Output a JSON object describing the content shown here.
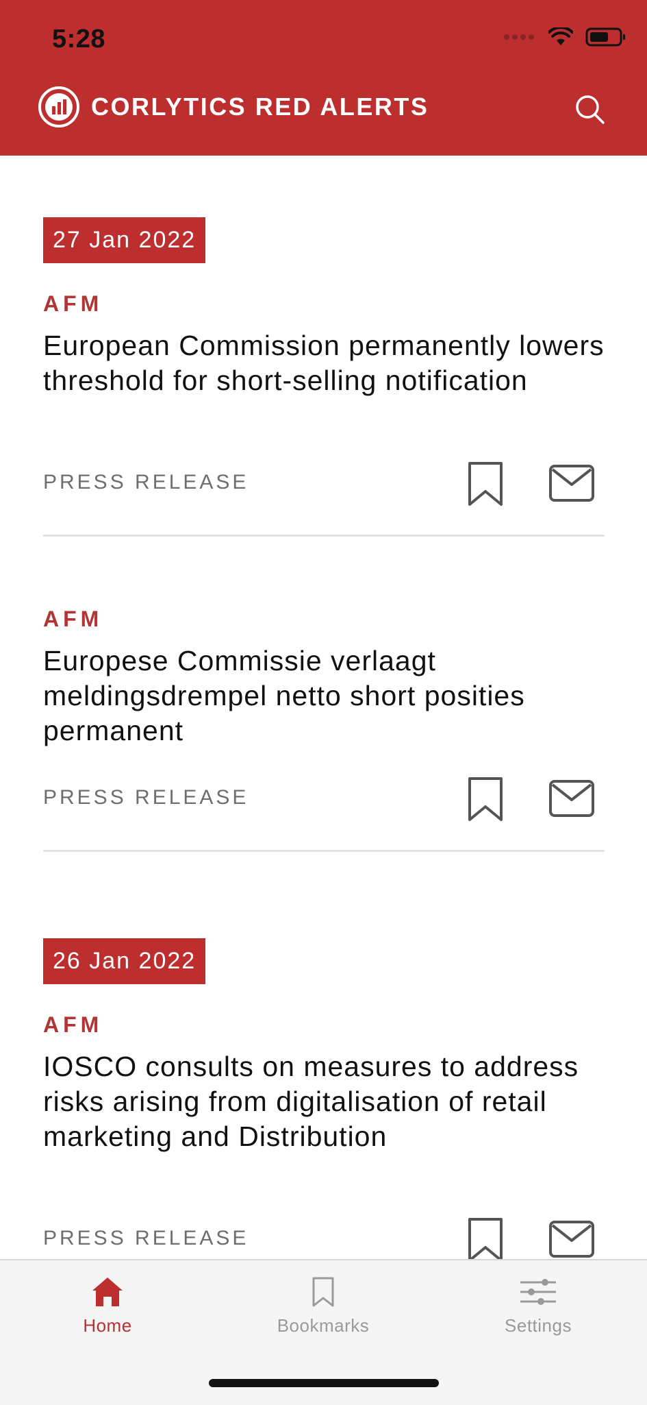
{
  "status": {
    "time": "5:28"
  },
  "header": {
    "title": "CORLYTICS RED ALERTS"
  },
  "icons": {
    "logo": "corlytics-logo",
    "search": "search-icon",
    "bookmark": "bookmark-icon",
    "email": "email-icon",
    "home": "home-icon",
    "settings": "sliders-icon"
  },
  "colors": {
    "brand": "#bd2e2e",
    "source": "#b23434",
    "inactive": "#9a9a9a"
  },
  "feed": {
    "items": [
      {
        "date": "27 Jan 2022",
        "source": "AFM",
        "title": "European Commission permanently lowers threshold for short-selling notification",
        "type": "PRESS RELEASE"
      },
      {
        "source": "AFM",
        "title": "Europese Commissie verlaagt meldingsdrempel netto short posities permanent",
        "type": "PRESS RELEASE"
      },
      {
        "date": "26 Jan 2022",
        "source": "AFM",
        "title": "IOSCO consults on measures to address risks arising from digitalisation of retail marketing and Distribution",
        "type": "PRESS RELEASE"
      }
    ]
  },
  "tabbar": {
    "tabs": [
      {
        "label": "Home",
        "active": true
      },
      {
        "label": "Bookmarks",
        "active": false
      },
      {
        "label": "Settings",
        "active": false
      }
    ]
  }
}
